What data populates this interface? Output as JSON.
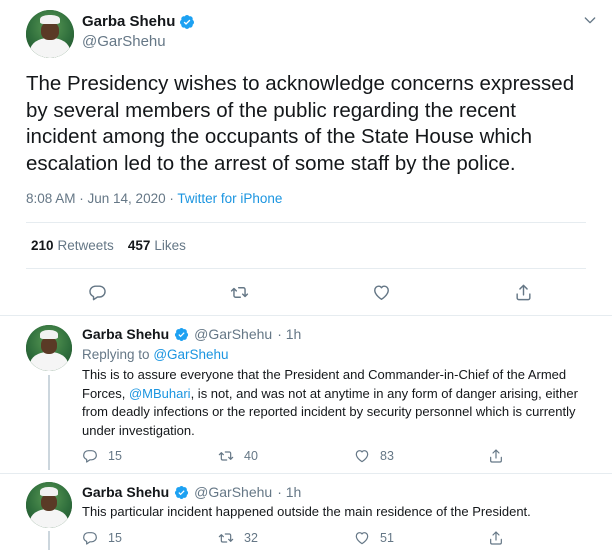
{
  "main_tweet": {
    "author_name": "Garba Shehu",
    "author_handle": "@GarShehu",
    "text": "The Presidency wishes to acknowledge concerns expressed by several members of the public regarding the recent incident among the occupants of the State House which escalation led to the arrest of some staff by the police.",
    "timestamp": "8:08 AM · Jun 14, 2020",
    "source": "Twitter for iPhone",
    "retweets_count": "210",
    "retweets_label": "Retweets",
    "likes_count": "457",
    "likes_label": "Likes"
  },
  "replies": [
    {
      "author_name": "Garba Shehu",
      "author_handle": "@GarShehu",
      "time": "· 1h",
      "replying_prefix": "Replying to",
      "replying_handle": "@GarShehu",
      "text_part1": "This is to assure everyone that the President and Commander-in-Chief of the Armed Forces, ",
      "mention": "@MBuhari",
      "text_part2": ", is not, and was not at anytime in any form of danger arising, either from deadly infections or the reported incident by security personnel which is currently under investigation.",
      "reply_count": "15",
      "retweet_count": "40",
      "like_count": "83"
    },
    {
      "author_name": "Garba Shehu",
      "author_handle": "@GarShehu",
      "time": "· 1h",
      "text": "This particular incident happened outside the main residence of the President.",
      "reply_count": "15",
      "retweet_count": "32",
      "like_count": "51"
    }
  ],
  "icons": {
    "verified": "verified-badge-icon",
    "caret": "chevron-down-icon",
    "reply": "reply-icon",
    "retweet": "retweet-icon",
    "like": "heart-icon",
    "share": "share-icon"
  },
  "colors": {
    "text": "#14171a",
    "secondary": "#657786",
    "link": "#1b95e0",
    "verified": "#1da1f2",
    "border": "#e6ecf0"
  }
}
